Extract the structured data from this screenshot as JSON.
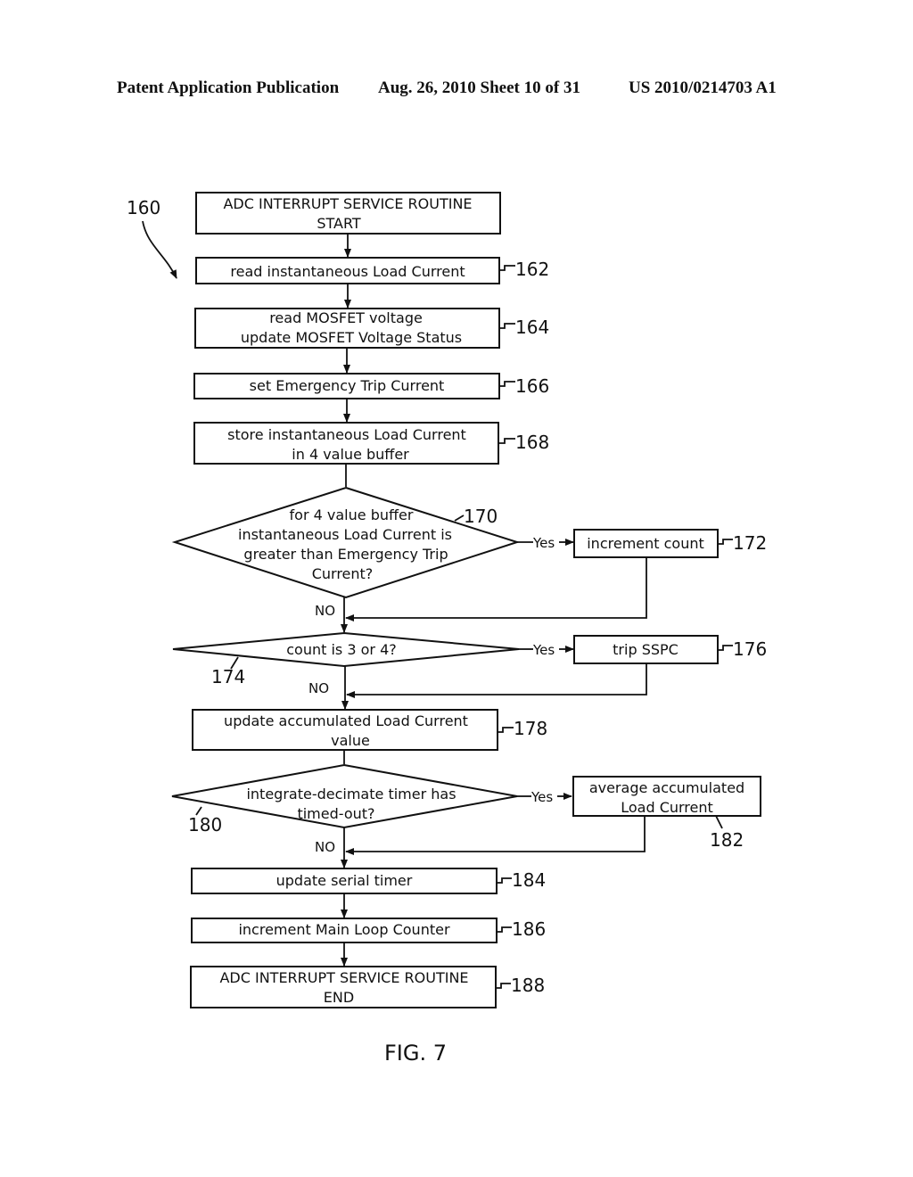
{
  "header": {
    "left": "Patent Application Publication",
    "center": "Aug. 26, 2010  Sheet 10 of 31",
    "right": "US 2010/0214703 A1"
  },
  "figure": {
    "label": "FIG. 7",
    "ref": "160"
  },
  "steps": {
    "start": {
      "lines": [
        "ADC INTERRUPT SERVICE ROUTINE",
        "START"
      ]
    },
    "s162": {
      "ref": "162",
      "lines": [
        "read instantaneous Load Current"
      ]
    },
    "s164": {
      "ref": "164",
      "lines": [
        "read MOSFET voltage",
        "update MOSFET Voltage Status"
      ]
    },
    "s166": {
      "ref": "166",
      "lines": [
        "set Emergency Trip Current"
      ]
    },
    "s168": {
      "ref": "168",
      "lines": [
        "store instantaneous Load Current",
        "in 4 value buffer"
      ]
    },
    "d170": {
      "ref": "170",
      "lines": [
        "for 4 value buffer",
        "instantaneous Load Current is",
        "greater than Emergency Trip",
        "Current?"
      ],
      "yes": "Yes",
      "no": "NO"
    },
    "s172": {
      "ref": "172",
      "lines": [
        "increment count"
      ]
    },
    "d174": {
      "ref": "174",
      "lines": [
        "count is 3 or 4?"
      ],
      "yes": "Yes",
      "no": "NO"
    },
    "s176": {
      "ref": "176",
      "lines": [
        "trip SSPC"
      ]
    },
    "s178": {
      "ref": "178",
      "lines": [
        "update accumulated Load Current",
        "value"
      ]
    },
    "d180": {
      "ref": "180",
      "lines": [
        "integrate-decimate timer has",
        "timed-out?"
      ],
      "yes": "Yes",
      "no": "NO"
    },
    "s182": {
      "ref": "182",
      "lines": [
        "average accumulated",
        "Load Current"
      ]
    },
    "s184": {
      "ref": "184",
      "lines": [
        "update serial timer"
      ]
    },
    "s186": {
      "ref": "186",
      "lines": [
        "increment Main Loop Counter"
      ]
    },
    "end": {
      "ref": "188",
      "lines": [
        "ADC INTERRUPT SERVICE ROUTINE",
        "END"
      ]
    }
  }
}
